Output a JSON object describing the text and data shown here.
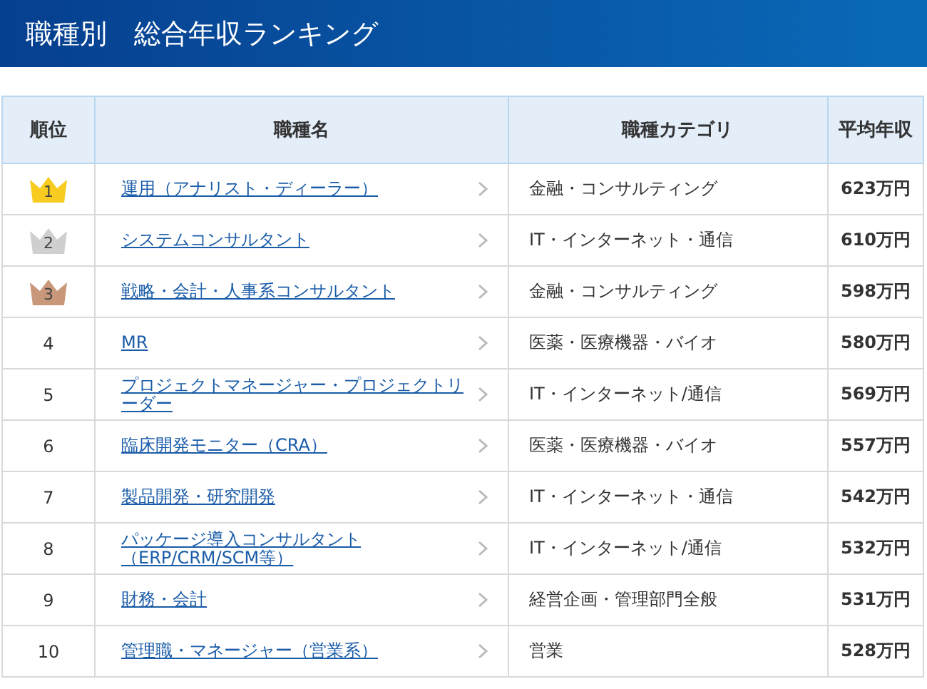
{
  "header": {
    "title": "職種別　総合年収ランキング"
  },
  "table": {
    "columns": [
      "順位",
      "職種名",
      "職種カテゴリ",
      "平均年収"
    ],
    "rows": [
      {
        "rank": "1",
        "kind": "crown",
        "color": "#f7cb1f",
        "name": "運用（アナリスト・ディーラー）",
        "category": "金融・コンサルティング",
        "salary": "623万円"
      },
      {
        "rank": "2",
        "kind": "crown",
        "color": "#cfcfcf",
        "name": "システムコンサルタント",
        "category": "IT・インターネット・通信",
        "salary": "610万円"
      },
      {
        "rank": "3",
        "kind": "crown",
        "color": "#c9977a",
        "name": "戦略・会計・人事系コンサルタント",
        "category": "金融・コンサルティング",
        "salary": "598万円"
      },
      {
        "rank": "4",
        "kind": "plain",
        "name": "MR",
        "category": "医薬・医療機器・バイオ",
        "salary": "580万円"
      },
      {
        "rank": "5",
        "kind": "plain",
        "name": "プロジェクトマネージャー・プロジェクトリーダー",
        "category": "IT・インターネット/通信",
        "salary": "569万円"
      },
      {
        "rank": "6",
        "kind": "plain",
        "name": "臨床開発モニター（CRA）",
        "category": "医薬・医療機器・バイオ",
        "salary": "557万円"
      },
      {
        "rank": "7",
        "kind": "plain",
        "name": "製品開発・研究開発",
        "category": "IT・インターネット・通信",
        "salary": "542万円"
      },
      {
        "rank": "8",
        "kind": "plain",
        "name": "パッケージ導入コンサルタント（ERP/CRM/SCM等）",
        "category": "IT・インターネット/通信",
        "salary": "532万円"
      },
      {
        "rank": "9",
        "kind": "plain",
        "name": "財務・会計",
        "category": "経営企画・管理部門全般",
        "salary": "531万円"
      },
      {
        "rank": "10",
        "kind": "plain",
        "name": "管理職・マネージャー（営業系）",
        "category": "営業",
        "salary": "528万円"
      }
    ]
  }
}
